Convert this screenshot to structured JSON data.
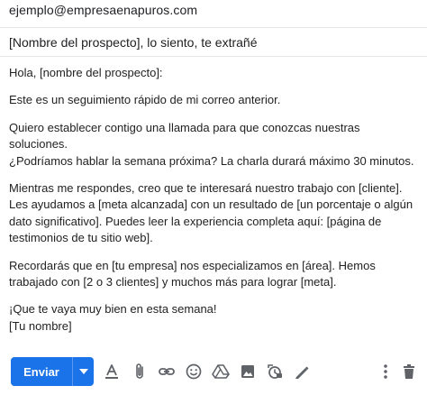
{
  "compose": {
    "to": "ejemplo@empresaenapuros.com",
    "subject": "[Nombre del prospecto], lo siento, te extrañé",
    "body": [
      "Hola, [nombre del prospecto]:",
      "Este es un seguimiento rápido de mi correo anterior.",
      "Quiero establecer contigo una llamada para que conozcas nuestras soluciones.\n¿Podríamos hablar la semana próxima? La charla durará máximo 30 minutos.",
      "Mientras me respondes, creo que te interesará nuestro trabajo con [cliente]. Les ayudamos a [meta alcanzada] con un resultado de [un porcentaje o algún dato significativo]. Puedes leer la experiencia completa aquí: [página de testimonios de tu sitio web].",
      "Recordarás que en [tu empresa] nos especializamos en [área]. Hemos trabajado con [2 o 3 clientes] y muchos más para lograr [meta].",
      "¡Que te vaya muy bien en esta semana!\n[Tu nombre]"
    ]
  },
  "toolbar": {
    "send_label": "Enviar",
    "icons": [
      "chevron-down-icon",
      "text-format-icon",
      "attach-icon",
      "link-icon",
      "emoji-icon",
      "drive-icon",
      "photo-icon",
      "confidential-icon",
      "signature-icon",
      "more-options-icon",
      "trash-icon"
    ]
  },
  "colors": {
    "accent": "#1a73e8",
    "icon": "#5f6368",
    "text": "#222222"
  }
}
